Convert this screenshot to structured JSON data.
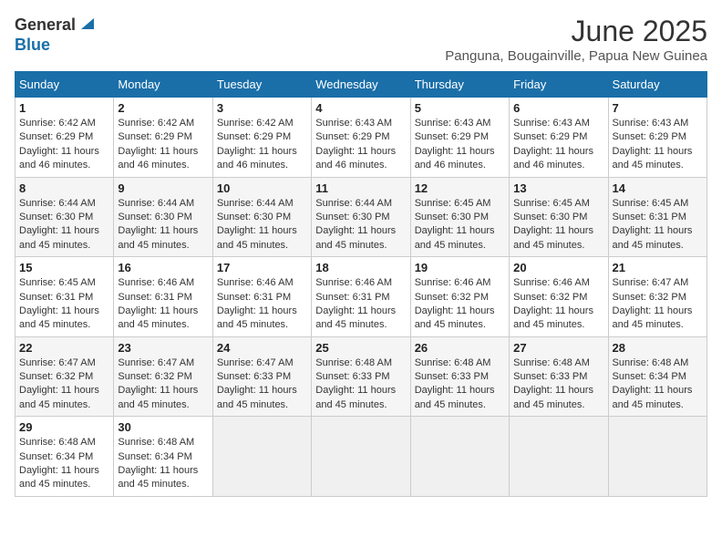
{
  "logo": {
    "general": "General",
    "blue": "Blue"
  },
  "title": {
    "month_year": "June 2025",
    "location": "Panguna, Bougainville, Papua New Guinea"
  },
  "weekdays": [
    "Sunday",
    "Monday",
    "Tuesday",
    "Wednesday",
    "Thursday",
    "Friday",
    "Saturday"
  ],
  "weeks": [
    [
      {
        "day": "1",
        "sunrise": "6:42 AM",
        "sunset": "6:29 PM",
        "daylight": "11 hours and 46 minutes."
      },
      {
        "day": "2",
        "sunrise": "6:42 AM",
        "sunset": "6:29 PM",
        "daylight": "11 hours and 46 minutes."
      },
      {
        "day": "3",
        "sunrise": "6:42 AM",
        "sunset": "6:29 PM",
        "daylight": "11 hours and 46 minutes."
      },
      {
        "day": "4",
        "sunrise": "6:43 AM",
        "sunset": "6:29 PM",
        "daylight": "11 hours and 46 minutes."
      },
      {
        "day": "5",
        "sunrise": "6:43 AM",
        "sunset": "6:29 PM",
        "daylight": "11 hours and 46 minutes."
      },
      {
        "day": "6",
        "sunrise": "6:43 AM",
        "sunset": "6:29 PM",
        "daylight": "11 hours and 46 minutes."
      },
      {
        "day": "7",
        "sunrise": "6:43 AM",
        "sunset": "6:29 PM",
        "daylight": "11 hours and 45 minutes."
      }
    ],
    [
      {
        "day": "8",
        "sunrise": "6:44 AM",
        "sunset": "6:30 PM",
        "daylight": "11 hours and 45 minutes."
      },
      {
        "day": "9",
        "sunrise": "6:44 AM",
        "sunset": "6:30 PM",
        "daylight": "11 hours and 45 minutes."
      },
      {
        "day": "10",
        "sunrise": "6:44 AM",
        "sunset": "6:30 PM",
        "daylight": "11 hours and 45 minutes."
      },
      {
        "day": "11",
        "sunrise": "6:44 AM",
        "sunset": "6:30 PM",
        "daylight": "11 hours and 45 minutes."
      },
      {
        "day": "12",
        "sunrise": "6:45 AM",
        "sunset": "6:30 PM",
        "daylight": "11 hours and 45 minutes."
      },
      {
        "day": "13",
        "sunrise": "6:45 AM",
        "sunset": "6:30 PM",
        "daylight": "11 hours and 45 minutes."
      },
      {
        "day": "14",
        "sunrise": "6:45 AM",
        "sunset": "6:31 PM",
        "daylight": "11 hours and 45 minutes."
      }
    ],
    [
      {
        "day": "15",
        "sunrise": "6:45 AM",
        "sunset": "6:31 PM",
        "daylight": "11 hours and 45 minutes."
      },
      {
        "day": "16",
        "sunrise": "6:46 AM",
        "sunset": "6:31 PM",
        "daylight": "11 hours and 45 minutes."
      },
      {
        "day": "17",
        "sunrise": "6:46 AM",
        "sunset": "6:31 PM",
        "daylight": "11 hours and 45 minutes."
      },
      {
        "day": "18",
        "sunrise": "6:46 AM",
        "sunset": "6:31 PM",
        "daylight": "11 hours and 45 minutes."
      },
      {
        "day": "19",
        "sunrise": "6:46 AM",
        "sunset": "6:32 PM",
        "daylight": "11 hours and 45 minutes."
      },
      {
        "day": "20",
        "sunrise": "6:46 AM",
        "sunset": "6:32 PM",
        "daylight": "11 hours and 45 minutes."
      },
      {
        "day": "21",
        "sunrise": "6:47 AM",
        "sunset": "6:32 PM",
        "daylight": "11 hours and 45 minutes."
      }
    ],
    [
      {
        "day": "22",
        "sunrise": "6:47 AM",
        "sunset": "6:32 PM",
        "daylight": "11 hours and 45 minutes."
      },
      {
        "day": "23",
        "sunrise": "6:47 AM",
        "sunset": "6:32 PM",
        "daylight": "11 hours and 45 minutes."
      },
      {
        "day": "24",
        "sunrise": "6:47 AM",
        "sunset": "6:33 PM",
        "daylight": "11 hours and 45 minutes."
      },
      {
        "day": "25",
        "sunrise": "6:48 AM",
        "sunset": "6:33 PM",
        "daylight": "11 hours and 45 minutes."
      },
      {
        "day": "26",
        "sunrise": "6:48 AM",
        "sunset": "6:33 PM",
        "daylight": "11 hours and 45 minutes."
      },
      {
        "day": "27",
        "sunrise": "6:48 AM",
        "sunset": "6:33 PM",
        "daylight": "11 hours and 45 minutes."
      },
      {
        "day": "28",
        "sunrise": "6:48 AM",
        "sunset": "6:34 PM",
        "daylight": "11 hours and 45 minutes."
      }
    ],
    [
      {
        "day": "29",
        "sunrise": "6:48 AM",
        "sunset": "6:34 PM",
        "daylight": "11 hours and 45 minutes."
      },
      {
        "day": "30",
        "sunrise": "6:48 AM",
        "sunset": "6:34 PM",
        "daylight": "11 hours and 45 minutes."
      },
      null,
      null,
      null,
      null,
      null
    ]
  ]
}
